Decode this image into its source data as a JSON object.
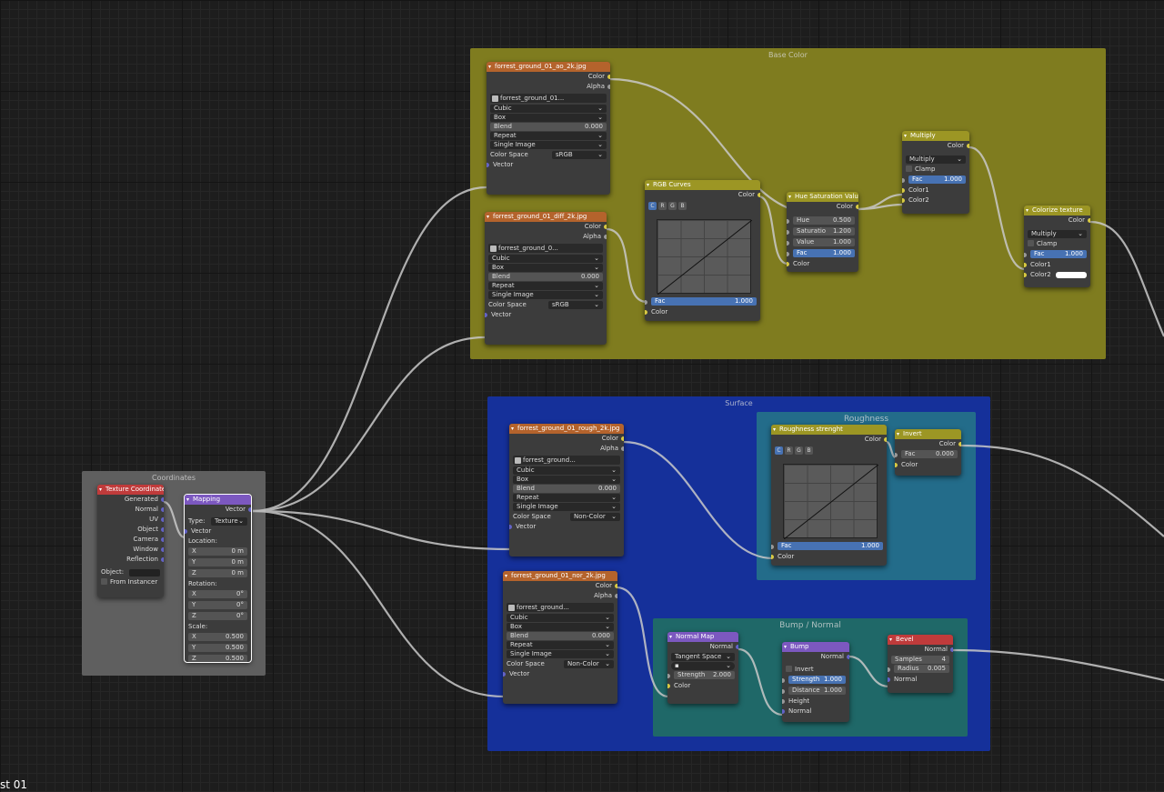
{
  "frames": {
    "base_color": "Base Color",
    "surface": "Surface",
    "roughness": "Roughness",
    "bump": "Bump / Normal",
    "coords": "Coordinates"
  },
  "tex_ao": {
    "title": "forrest_ground_01_ao_2k.jpg",
    "image": "forrest_ground_01...",
    "interp": "Cubic",
    "proj": "Box",
    "blend_label": "Blend",
    "blend": "0.000",
    "ext": "Repeat",
    "source": "Single Image",
    "cs_label": "Color Space",
    "cs": "sRGB",
    "out_color": "Color",
    "out_alpha": "Alpha",
    "in_vector": "Vector"
  },
  "tex_diff": {
    "title": "forrest_ground_01_diff_2k.jpg",
    "image": "forrest_ground_0...",
    "interp": "Cubic",
    "proj": "Box",
    "blend_label": "Blend",
    "blend": "0.000",
    "ext": "Repeat",
    "source": "Single Image",
    "cs_label": "Color Space",
    "cs": "sRGB",
    "out_color": "Color",
    "out_alpha": "Alpha",
    "in_vector": "Vector"
  },
  "tex_rough": {
    "title": "forrest_ground_01_rough_2k.jpg",
    "image": "forrest_ground...",
    "interp": "Cubic",
    "proj": "Box",
    "blend_label": "Blend",
    "blend": "0.000",
    "ext": "Repeat",
    "source": "Single Image",
    "cs_label": "Color Space",
    "cs": "Non-Color",
    "out_color": "Color",
    "out_alpha": "Alpha",
    "in_vector": "Vector"
  },
  "tex_nor": {
    "title": "forrest_ground_01_nor_2k.jpg",
    "image": "forrest_ground...",
    "interp": "Cubic",
    "proj": "Box",
    "blend_label": "Blend",
    "blend": "0.000",
    "ext": "Repeat",
    "source": "Single Image",
    "cs_label": "Color Space",
    "cs": "Non-Color",
    "out_color": "Color",
    "out_alpha": "Alpha",
    "in_vector": "Vector"
  },
  "rgb_curves": {
    "title": "RGB Curves",
    "out": "Color",
    "fac_label": "Fac",
    "fac": "1.000",
    "in_color": "Color",
    "channels": [
      "C",
      "R",
      "G",
      "B"
    ]
  },
  "hsv": {
    "title": "Hue Saturation Value",
    "out": "Color",
    "hue_label": "Hue",
    "hue": "0.500",
    "sat_label": "Saturatio",
    "sat": "1.200",
    "val_label": "Value",
    "val": "1.000",
    "fac_label": "Fac",
    "fac": "1.000",
    "in_color": "Color"
  },
  "multiply": {
    "title": "Multiply",
    "out": "Color",
    "mode": "Multiply",
    "clamp": "Clamp",
    "fac_label": "Fac",
    "fac": "1.000",
    "in1": "Color1",
    "in2": "Color2"
  },
  "colorize": {
    "title": "Colorize texture",
    "out": "Color",
    "mode": "Multiply",
    "clamp": "Clamp",
    "fac_label": "Fac",
    "fac": "1.000",
    "in1": "Color1",
    "in2": "Color2"
  },
  "rough_strength": {
    "title": "Roughness strenght",
    "out": "Color",
    "fac_label": "Fac",
    "fac": "1.000",
    "in_color": "Color",
    "channels": [
      "C",
      "R",
      "G",
      "B"
    ]
  },
  "invert": {
    "title": "Invert",
    "out": "Color",
    "fac_label": "Fac",
    "fac": "0.000",
    "in_color": "Color"
  },
  "normal_map": {
    "title": "Normal Map",
    "out": "Normal",
    "space": "Tangent Space",
    "str_label": "Strength",
    "strength": "2.000",
    "in_color": "Color"
  },
  "bump": {
    "title": "Bump",
    "out": "Normal",
    "invert": "Invert",
    "str_label": "Strength",
    "strength": "1.000",
    "dist_label": "Distance",
    "distance": "1.000",
    "in_height": "Height",
    "in_normal": "Normal"
  },
  "bevel": {
    "title": "Bevel",
    "out": "Normal",
    "samples_label": "Samples",
    "samples": "4",
    "radius_label": "Radius",
    "radius": "0.005",
    "in_normal": "Normal"
  },
  "texcoord": {
    "title": "Texture Coordinate",
    "outs": [
      "Generated",
      "Normal",
      "UV",
      "Object",
      "Camera",
      "Window",
      "Reflection"
    ],
    "object_label": "Object:",
    "from_instancer": "From Instancer"
  },
  "mapping": {
    "title": "Mapping",
    "out": "Vector",
    "type_label": "Type:",
    "type": "Texture",
    "in_vector": "Vector",
    "loc_label": "Location:",
    "loc": [
      "0 m",
      "0 m",
      "0 m"
    ],
    "rot_label": "Rotation:",
    "rot": [
      "0°",
      "0°",
      "0°"
    ],
    "scale_label": "Scale:",
    "scale": [
      "0.500",
      "0.500",
      "0.500"
    ],
    "axes": [
      "X",
      "Y",
      "Z"
    ]
  },
  "footer_text": "st 01"
}
